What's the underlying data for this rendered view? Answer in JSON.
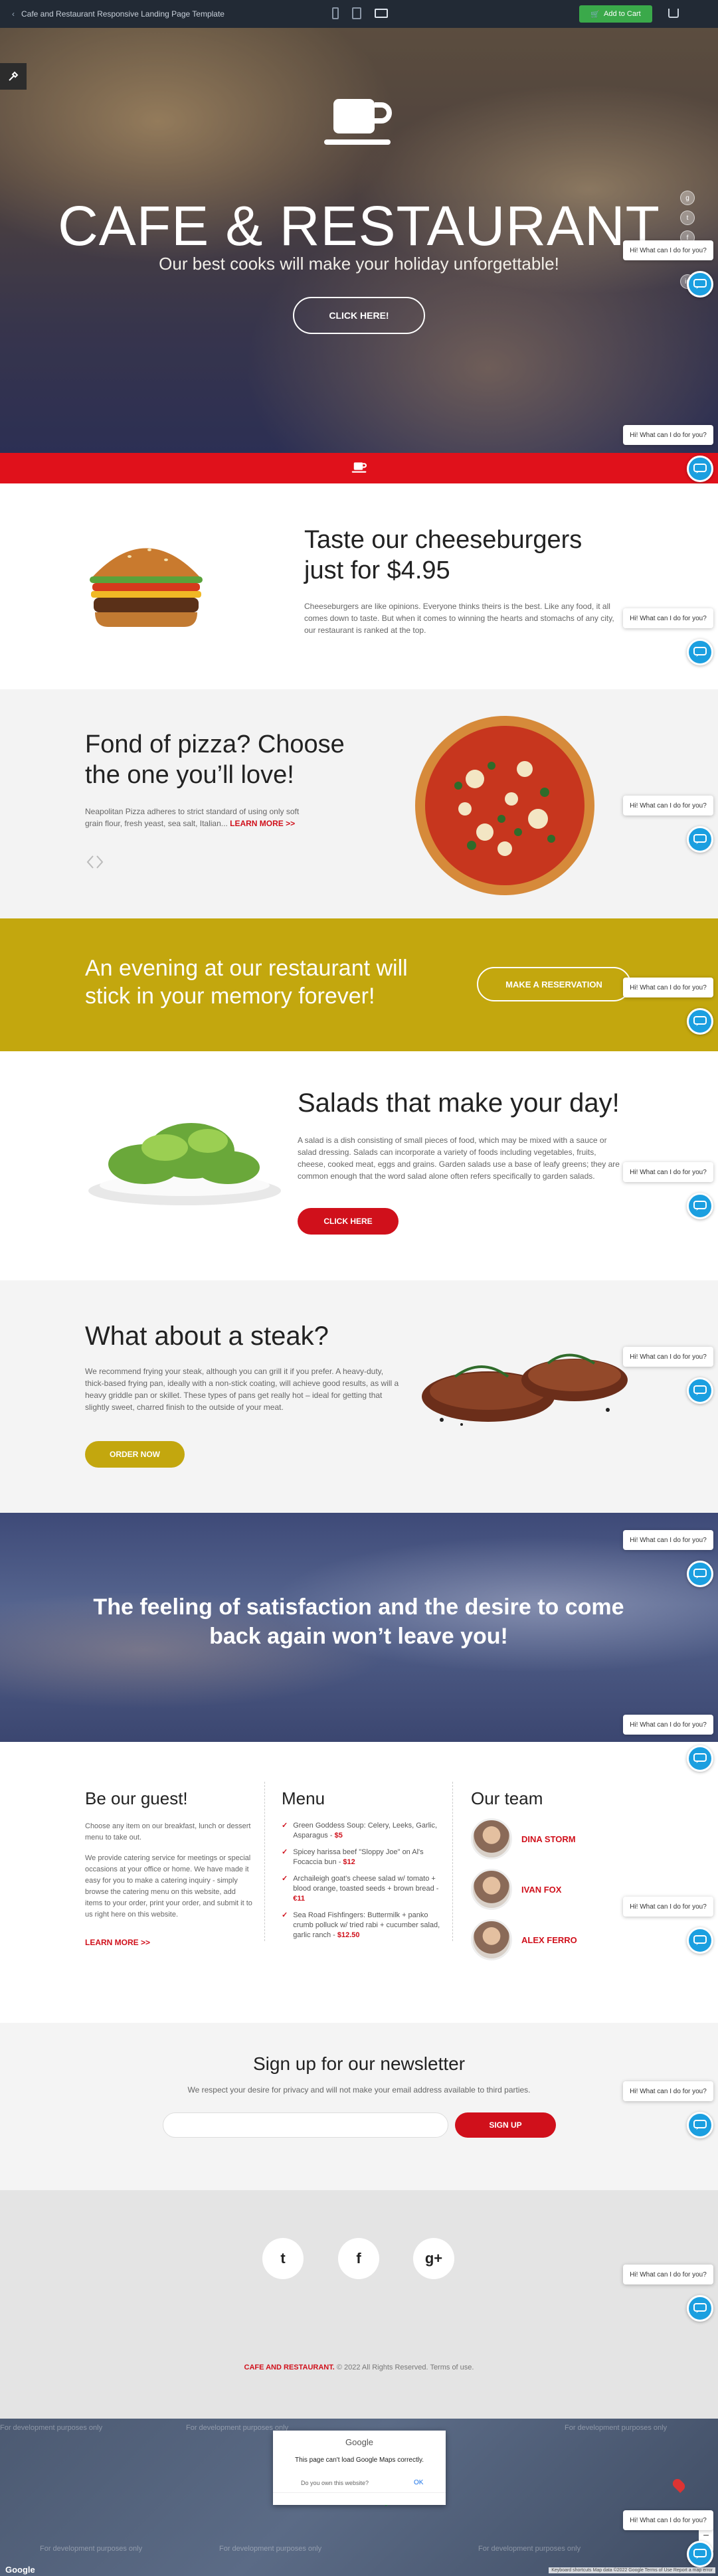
{
  "topbar": {
    "back": "‹",
    "title": "Cafe and Restaurant Responsive Landing Page Template",
    "add_to_cart": "Add to Cart"
  },
  "hero": {
    "title": "CAFE & RESTAURANT",
    "tagline": "Our best cooks will make your holiday unforgettable!",
    "button": "CLICK HERE!"
  },
  "chat": {
    "bubble": "Hi! What can I do for you?"
  },
  "burger": {
    "title": "Taste our cheeseburgers just for $4.95",
    "text": "Cheeseburgers are like opinions. Everyone thinks theirs is the best. Like any food, it all comes down to taste. But when it comes to winning the hearts and stomachs of any city, our restaurant is ranked at the top."
  },
  "pizza": {
    "title": "Fond of pizza? Choose the one you’ll love!",
    "text": "Neapolitan Pizza adheres to strict standard of using only soft grain flour, fresh yeast, sea salt, Italian...",
    "link": "LEARN MORE >>"
  },
  "evening": {
    "title": "An evening at our restaurant will stick in your memory forever!",
    "button": "MAKE A RESERVATION"
  },
  "salad": {
    "title": "Salads that make your day!",
    "text": "A salad is a dish consisting of small pieces of food, which may be mixed with a sauce or salad dressing. Salads can incorporate a variety of foods including vegetables, fruits, cheese, cooked meat, eggs and grains. Garden salads use a base of leafy greens; they are common enough that the word salad alone often refers specifically to garden salads.",
    "button": "CLICK HERE"
  },
  "steak": {
    "title": "What about a steak?",
    "text": "We recommend frying your steak, although you can grill it if you prefer. A heavy-duty, thick-based frying pan, ideally with a non-stick coating, will achieve good results, as will a heavy griddle pan or skillet. These types of pans get really hot – ideal for getting that slightly sweet, charred finish to the outside of your meat.",
    "button": "ORDER NOW"
  },
  "feeling": {
    "title": "The feeling of satisfaction and the desire to come back again won’t leave you!"
  },
  "guest": {
    "title": "Be our guest!",
    "p1": "Choose any item on our breakfast, lunch or dessert menu to take out.",
    "p2": "We provide catering service for meetings or special occasions at your office or home. We have made it easy for you to make a catering inquiry - simply browse the catering menu on this website, add items to your order, print your order, and submit it to us right here on this website.",
    "link": "LEARN MORE >>"
  },
  "menu": {
    "title": "Menu",
    "items": [
      {
        "text": "Green Goddess Soup: Celery, Leeks, Garlic, Asparagus - ",
        "price": "$5"
      },
      {
        "text": "Spicey harissa beef \"Sloppy Joe\" on Al's Focaccia bun - ",
        "price": "$12"
      },
      {
        "text": "Archaileigh goat's cheese salad w/ tomato + blood orange, toasted seeds + brown bread - ",
        "price": "€11"
      },
      {
        "text": "Sea Road Fishfingers: Buttermilk + panko crumb polluck w/ tried rabi + cucumber salad, garlic ranch - ",
        "price": "$12.50"
      }
    ]
  },
  "team": {
    "title": "Our team",
    "members": [
      "DINA STORM",
      "IVAN FOX",
      "ALEX FERRO"
    ]
  },
  "newsletter": {
    "title": "Sign up for our newsletter",
    "subtitle": "We respect your desire for privacy and will not make your email address available to third parties.",
    "placeholder": "",
    "button": "SIGN UP"
  },
  "social": {
    "twitter": "t",
    "facebook": "f",
    "gplus": "g+"
  },
  "footer": {
    "brand": "CAFE AND RESTAURANT.",
    "copy": " © 2022 All Rights Reserved. Terms of use."
  },
  "map": {
    "watermark": "For development purposes only",
    "dialog_title": "Google",
    "dialog_msg": "This page can't load Google Maps correctly.",
    "dialog_q": "Do you own this website?",
    "dialog_ok": "OK",
    "google": "Google",
    "attribution": "Keyboard shortcuts   Map data ©2022 Google   Terms of Use   Report a map error"
  },
  "colors": {
    "red": "#e0111b",
    "olive": "#c3a70e",
    "chat": "#1b9fe0",
    "topbar": "#222a35"
  }
}
